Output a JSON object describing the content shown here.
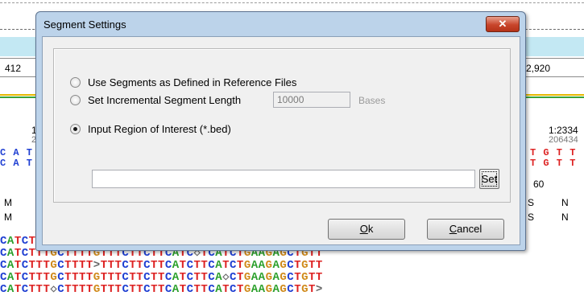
{
  "background": {
    "ruler_left": "412",
    "ruler_right": "2,920",
    "pos_left": "1",
    "pos_left_sub": "2",
    "pos_right": "1:2334",
    "pos_right_sub": "206434",
    "mid_number": "60",
    "left_col_rows": [
      "C A T",
      "C A T"
    ],
    "right_col_rows": [
      "T G T T",
      "T G T T"
    ],
    "m_labels": [
      "M",
      "M"
    ],
    "n_labels": [
      "N",
      "N"
    ],
    "s_labels": [
      "S",
      "S"
    ],
    "sequence_rows": [
      "CATCTTTGCTTTTGTTTCTTCTTCATCTTCATCTGAAGAGCTGTT",
      "CATCTTTGCTTTTGTTTCTTCTTCATC◇TCATCTGAAGAGCTGTT",
      "CATCTTTGCTTTT>TTTCTTCTTCATCTTCATCTGAAGAGCTGTT",
      "CATCTTTGCTTTTGTTTCTTCTTCATCTTCA◇CTGAAGAGCTGTT",
      "CATCTTT◇CTTTTGTTTCTTCTTCATCTTCATCTGAAGAGCTGT>"
    ],
    "colors": {
      "A": "#2a9f2a",
      "T": "#d22",
      "C": "#1f3fd2",
      "G": "#d08a1a"
    }
  },
  "dialog": {
    "title": "Segment Settings",
    "close_glyph": "✕",
    "options": [
      {
        "label": "Use Segments as Defined in Reference Files",
        "checked": false
      },
      {
        "label": "Set Incremental Segment Length",
        "checked": false
      },
      {
        "label": "Input Region of Interest (*.bed)",
        "checked": true
      }
    ],
    "segment_length_value": "10000",
    "bases_label": "Bases",
    "bed_path_value": "",
    "set_button": "Set",
    "ok_button": {
      "mnemonic": "O",
      "rest": "k"
    },
    "cancel_button": {
      "mnemonic": "C",
      "rest": "ancel"
    }
  }
}
